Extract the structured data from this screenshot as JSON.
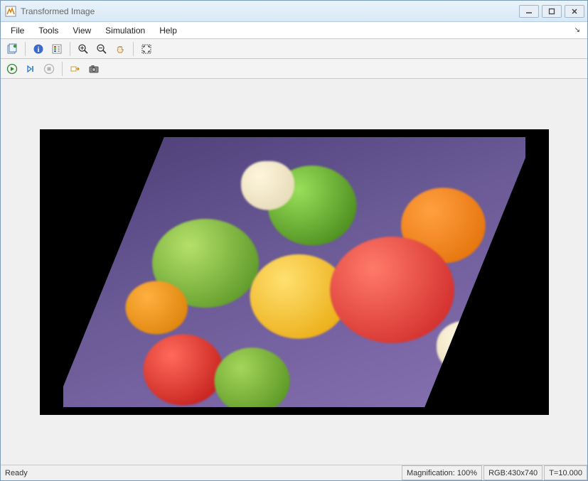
{
  "window": {
    "title": "Transformed Image"
  },
  "menu": {
    "items": [
      "File",
      "Tools",
      "View",
      "Simulation",
      "Help"
    ]
  },
  "toolbar1": {
    "icons": [
      "new-figure-icon",
      "info-icon",
      "settings-icon",
      "zoom-in-icon",
      "zoom-out-icon",
      "pan-icon",
      "fit-icon"
    ]
  },
  "toolbar2": {
    "icons": [
      "run-icon",
      "step-icon",
      "stop-icon",
      "highlight-icon",
      "snapshot-icon"
    ]
  },
  "status": {
    "ready": "Ready",
    "magnification_label": "Magnification:",
    "magnification_value": "100%",
    "rgb_label": "RGB:",
    "rgb_value": "430x740",
    "time_label": "T=",
    "time_value": "10.000"
  }
}
